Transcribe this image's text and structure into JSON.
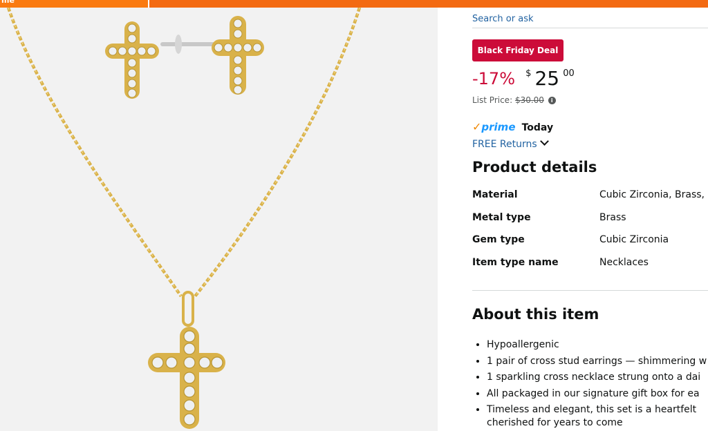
{
  "topbar": {
    "label": "me",
    "color": "#f36a12"
  },
  "search": {
    "link_text": "Search or ask"
  },
  "deal": {
    "badge": "Black Friday Deal",
    "color": "#cc0c39"
  },
  "price": {
    "discount": "-17%",
    "currency": "$",
    "whole": "25",
    "fraction": "00",
    "list_label": "List Price:",
    "list_value": "$30.00",
    "info_icon": "info-icon"
  },
  "delivery": {
    "prime_mark": "✓",
    "prime_word": "prime",
    "prime_today": "Today",
    "returns": "FREE Returns"
  },
  "product_details": {
    "heading": "Product details",
    "rows": [
      {
        "key": "Material",
        "value": "Cubic Zirconia, Brass,"
      },
      {
        "key": "Metal type",
        "value": "Brass"
      },
      {
        "key": "Gem type",
        "value": "Cubic Zirconia"
      },
      {
        "key": "Item type name",
        "value": "Necklaces"
      }
    ]
  },
  "about": {
    "heading": "About this item",
    "bullets": [
      "Hypoallergenic",
      "1 pair of cross stud earrings — shimmering w",
      "1 sparkling cross necklace strung onto a dai",
      "All packaged in our signature gift box for ea",
      "Timeless and elegant, this set is a heartfelt"
    ],
    "bullet_continuation": "cherished for years to come"
  },
  "image": {
    "description_icon": "product-photo",
    "gold": "#d9b24a",
    "stone": "#e9ecef"
  }
}
